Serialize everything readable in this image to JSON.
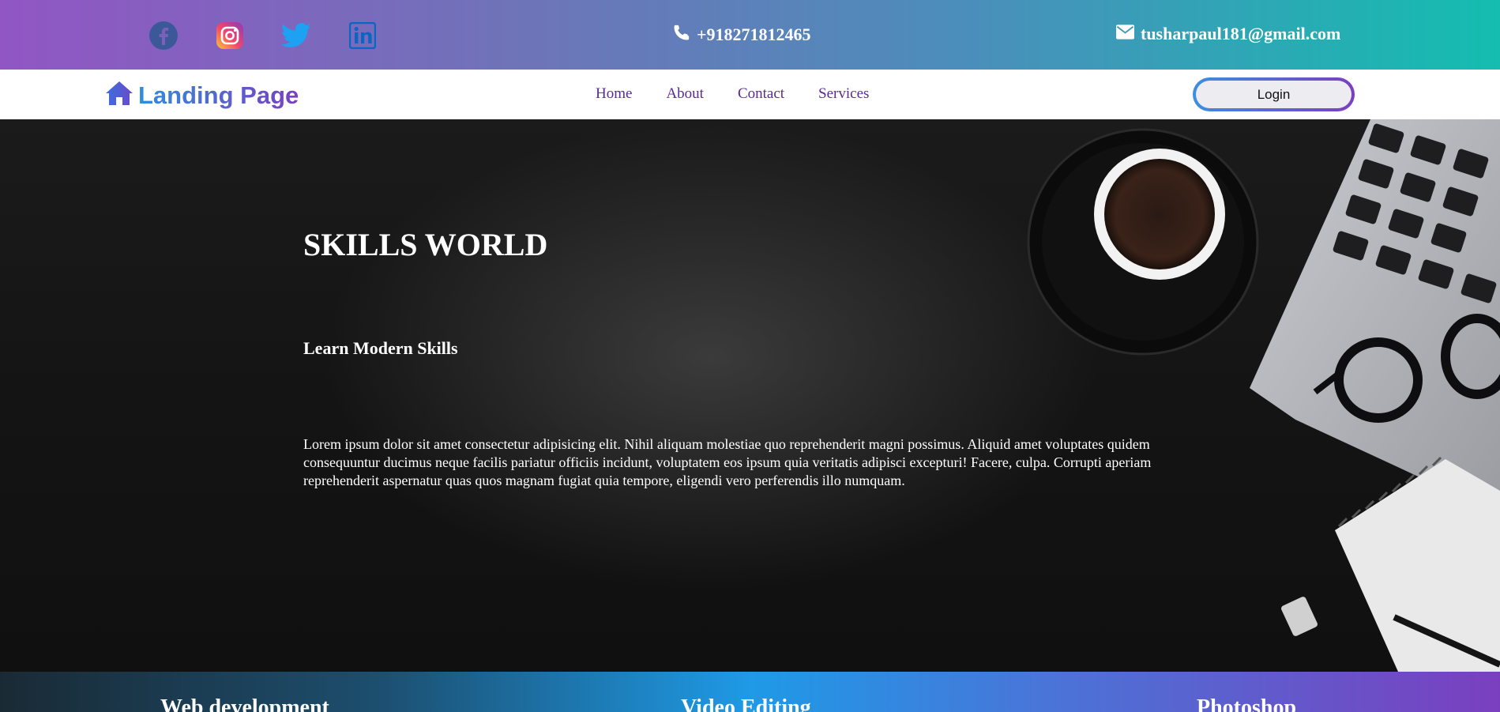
{
  "topbar": {
    "social": [
      {
        "name": "facebook-icon"
      },
      {
        "name": "instagram-icon"
      },
      {
        "name": "twitter-icon"
      },
      {
        "name": "linkedin-icon"
      }
    ],
    "phone": "+918271812465",
    "email": "tusharpaul181@gmail.com"
  },
  "navbar": {
    "brand_icon": "home-icon",
    "brand": "Landing Page",
    "links": [
      "Home",
      "About",
      "Contact",
      "Services"
    ],
    "login": "Login"
  },
  "hero": {
    "title": "SKILLS WORLD",
    "subtitle": "Learn Modern Skills",
    "text": "Lorem ipsum dolor sit amet consectetur adipisicing elit. Nihil aliquam molestiae quo reprehenderit magni possimus. Aliquid amet voluptates quidem consequuntur ducimus neque facilis pariatur officiis incidunt, voluptatem eos ipsum quia veritatis adipisci excepturi! Facere, culpa. Corrupti aperiam reprehenderit aspernatur quas quos magnam fugiat quia tempore, eligendi vero perferendis illo numquam."
  },
  "skills": [
    "Web development",
    "Video Editing",
    "Photoshop"
  ],
  "colors": {
    "nav_link": "#5a2a96",
    "facebook": "#3b5998",
    "twitter": "#1da1f2",
    "linkedin": "#0a66c2"
  }
}
